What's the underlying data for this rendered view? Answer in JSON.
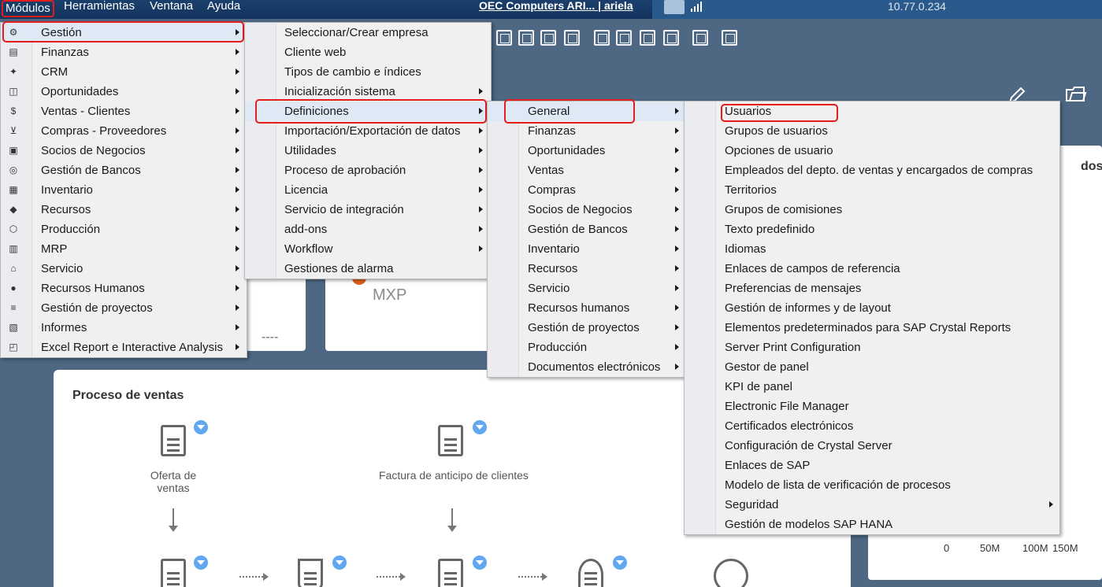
{
  "menubar": {
    "modulos": "Módulos",
    "herramientas": "Herramientas",
    "ventana": "Ventana",
    "ayuda": "Ayuda"
  },
  "session": {
    "company": "OEC Computers ARI... | ariela",
    "ip": "10.77.0.234"
  },
  "menu_modulos": [
    {
      "label": "Gestión",
      "icon": "gear-icon",
      "has_sub": true
    },
    {
      "label": "Finanzas",
      "icon": "ledger-icon",
      "has_sub": true
    },
    {
      "label": "CRM",
      "icon": "people-star-icon",
      "has_sub": true
    },
    {
      "label": "Oportunidades",
      "icon": "chart-icon",
      "has_sub": true
    },
    {
      "label": "Ventas - Clientes",
      "icon": "dollar-doc-icon",
      "has_sub": true
    },
    {
      "label": "Compras - Proveedores",
      "icon": "cart-icon",
      "has_sub": true
    },
    {
      "label": "Socios de Negocios",
      "icon": "contact-card-icon",
      "has_sub": true
    },
    {
      "label": "Gestión de Bancos",
      "icon": "money-bag-icon",
      "has_sub": true
    },
    {
      "label": "Inventario",
      "icon": "boxes-icon",
      "has_sub": true
    },
    {
      "label": "Recursos",
      "icon": "cube-icon",
      "has_sub": true
    },
    {
      "label": "Producción",
      "icon": "package-icon",
      "has_sub": true
    },
    {
      "label": "MRP",
      "icon": "calendar-grid-icon",
      "has_sub": true
    },
    {
      "label": "Servicio",
      "icon": "building-icon",
      "has_sub": true
    },
    {
      "label": "Recursos Humanos",
      "icon": "person-icon",
      "has_sub": true
    },
    {
      "label": "Gestión de proyectos",
      "icon": "project-list-icon",
      "has_sub": true
    },
    {
      "label": "Informes",
      "icon": "report-icon",
      "has_sub": true
    },
    {
      "label": "Excel Report e Interactive Analysis",
      "icon": "excel-report-icon",
      "has_sub": true
    }
  ],
  "menu_gestion": [
    {
      "label": "Seleccionar/Crear empresa",
      "has_sub": false
    },
    {
      "label": "Cliente web",
      "has_sub": false
    },
    {
      "label": "Tipos de cambio e índices",
      "has_sub": false
    },
    {
      "label": "Inicialización sistema",
      "has_sub": true
    },
    {
      "label": "Definiciones",
      "has_sub": true
    },
    {
      "label": "Importación/Exportación de datos",
      "has_sub": true
    },
    {
      "label": "Utilidades",
      "has_sub": true
    },
    {
      "label": "Proceso de aprobación",
      "has_sub": true
    },
    {
      "label": "Licencia",
      "has_sub": true
    },
    {
      "label": "Servicio de integración",
      "has_sub": true
    },
    {
      "label": "add-ons",
      "has_sub": true
    },
    {
      "label": "Workflow",
      "has_sub": true
    },
    {
      "label": "Gestiones de alarma",
      "has_sub": false
    }
  ],
  "menu_definiciones": [
    {
      "label": "General",
      "has_sub": true
    },
    {
      "label": "Finanzas",
      "has_sub": true
    },
    {
      "label": "Oportunidades",
      "has_sub": true
    },
    {
      "label": "Ventas",
      "has_sub": true
    },
    {
      "label": "Compras",
      "has_sub": true
    },
    {
      "label": "Socios de Negocios",
      "has_sub": true
    },
    {
      "label": "Gestión de Bancos",
      "has_sub": true
    },
    {
      "label": "Inventario",
      "has_sub": true
    },
    {
      "label": "Recursos",
      "has_sub": true
    },
    {
      "label": "Servicio",
      "has_sub": true
    },
    {
      "label": "Recursos humanos",
      "has_sub": true
    },
    {
      "label": "Gestión de proyectos",
      "has_sub": true
    },
    {
      "label": "Producción",
      "has_sub": true
    },
    {
      "label": "Documentos electrónicos",
      "has_sub": true
    }
  ],
  "menu_general": [
    {
      "label": "Usuarios",
      "has_sub": false
    },
    {
      "label": "Grupos de usuarios",
      "has_sub": false
    },
    {
      "label": "Opciones de usuario",
      "has_sub": false
    },
    {
      "label": "Empleados del depto. de ventas y encargados de compras",
      "has_sub": false
    },
    {
      "label": "Territorios",
      "has_sub": false
    },
    {
      "label": "Grupos de comisiones",
      "has_sub": false
    },
    {
      "label": "Texto predefinido",
      "has_sub": false
    },
    {
      "label": "Idiomas",
      "has_sub": false
    },
    {
      "label": "Enlaces de campos de referencia",
      "has_sub": false
    },
    {
      "label": "Preferencias de mensajes",
      "has_sub": false
    },
    {
      "label": "Gestión de informes y de layout",
      "has_sub": false
    },
    {
      "label": "Elementos predeterminados para SAP Crystal Reports",
      "has_sub": false
    },
    {
      "label": "Server Print Configuration",
      "has_sub": false
    },
    {
      "label": "Gestor de panel",
      "has_sub": false
    },
    {
      "label": "KPI de panel",
      "has_sub": false
    },
    {
      "label": "Electronic File Manager",
      "has_sub": false
    },
    {
      "label": "Certificados electrónicos",
      "has_sub": false
    },
    {
      "label": "Configuración de Crystal Server",
      "has_sub": false
    },
    {
      "label": "Enlaces de SAP",
      "has_sub": false
    },
    {
      "label": "Modelo de lista de verificación de procesos",
      "has_sub": false
    },
    {
      "label": "Seguridad",
      "has_sub": true
    },
    {
      "label": "Gestión de modelos SAP HANA",
      "has_sub": false
    }
  ],
  "tiles": {
    "currency": "MXP",
    "dashes": "----",
    "right_title": "dos...",
    "axis": [
      "0",
      "50M",
      "100M",
      "150M"
    ]
  },
  "process": {
    "title": "Proceso de ventas",
    "oferta": "Oferta de\nventas",
    "factura_anticipo": "Factura de anticipo de clientes"
  },
  "colors": {
    "highlight": "#e31c1c",
    "accent": "#62a7f0",
    "topbar": "#13345d"
  }
}
